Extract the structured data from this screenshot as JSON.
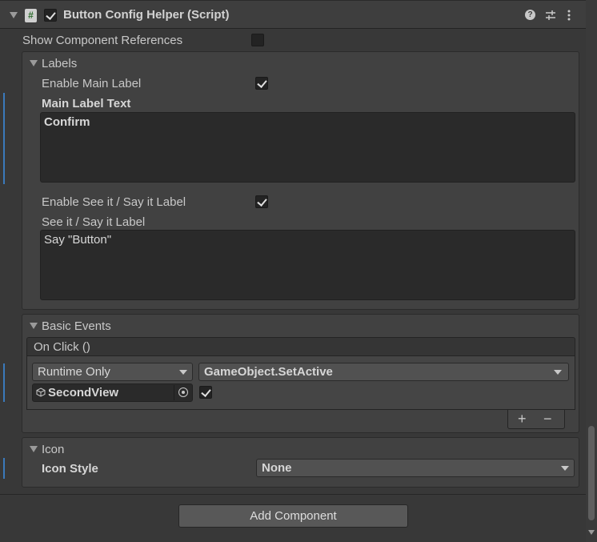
{
  "component": {
    "title": "Button Config Helper (Script)",
    "enabled": true,
    "script_glyph": "#",
    "header_icons": [
      "help-icon",
      "presets-icon",
      "more-icon"
    ]
  },
  "show_component_references": {
    "label": "Show Component References",
    "checked": false
  },
  "labels_section": {
    "title": "Labels",
    "enable_main_label": {
      "label": "Enable Main Label",
      "checked": true
    },
    "main_label_text": {
      "label": "Main Label Text",
      "value": "Confirm"
    },
    "enable_see_it": {
      "label": "Enable See it / Say it Label",
      "checked": true
    },
    "see_it_label": {
      "label": "See it / Say it Label",
      "value": "Say \"Button\""
    }
  },
  "basic_events": {
    "title": "Basic Events",
    "event_name": "On Click ()",
    "runtime_mode": "Runtime Only",
    "function": "GameObject.SetActive",
    "target_object": "SecondView",
    "argument_checked": true,
    "add_symbol": "+",
    "remove_symbol": "−"
  },
  "icon_section": {
    "title": "Icon",
    "icon_style": {
      "label": "Icon Style",
      "value": "None"
    }
  },
  "add_component": "Add Component",
  "colors": {
    "accent": "#3a79bb",
    "background": "#383838",
    "field": "#2a2a2a"
  }
}
